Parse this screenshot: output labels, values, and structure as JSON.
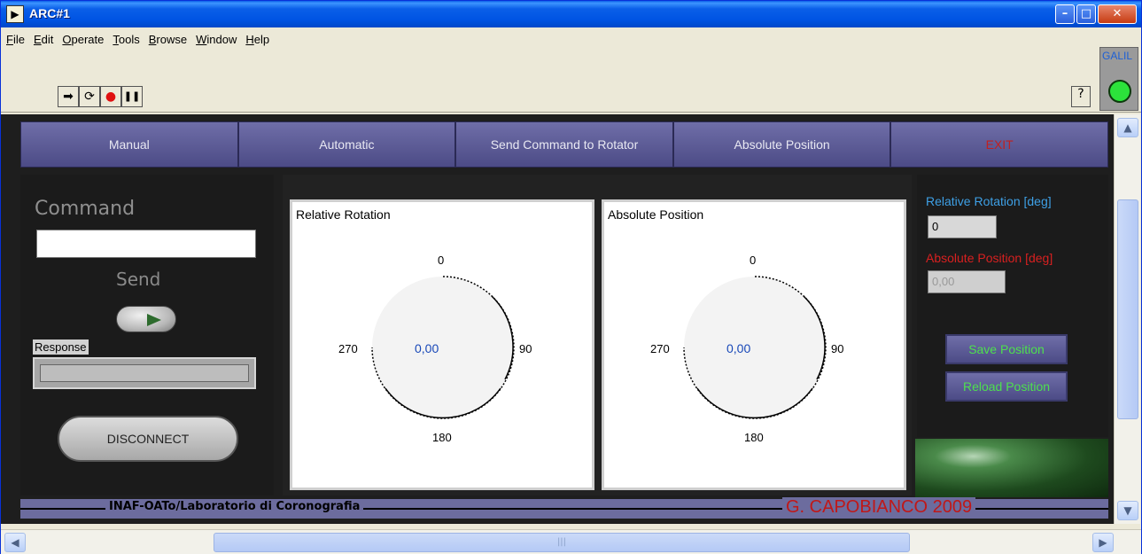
{
  "window": {
    "title": "ARC#1",
    "app_icon_glyph": "▶",
    "minimize_glyph": "–",
    "maximize_glyph": "□",
    "close_glyph": "✕"
  },
  "menu": {
    "items": [
      "File",
      "Edit",
      "Operate",
      "Tools",
      "Browse",
      "Window",
      "Help"
    ]
  },
  "toolbar": {
    "run_glyph": "➡",
    "run_continuous_glyph": "⟳",
    "abort_glyph": "●",
    "pause_glyph": "❚❚",
    "help_glyph": "?"
  },
  "galil": {
    "label": "GALIL",
    "led_color": "#2ce23b"
  },
  "tabs": [
    {
      "label": "Manual"
    },
    {
      "label": "Automatic"
    },
    {
      "label": "Send Command to Rotator"
    },
    {
      "label": "Absolute Position"
    },
    {
      "label": "EXIT"
    }
  ],
  "left": {
    "command_label": "Command",
    "command_value": "",
    "send_label": "Send",
    "response_label": "Response",
    "response_value": "",
    "disconnect_label": "DISCONNECT"
  },
  "gauges": [
    {
      "title": "Relative Rotation",
      "value": "0,00",
      "tick_top": "0",
      "tick_right": "90",
      "tick_bottom": "180",
      "tick_left": "270"
    },
    {
      "title": "Absolute Position",
      "value": "0,00",
      "tick_top": "0",
      "tick_right": "90",
      "tick_bottom": "180",
      "tick_left": "270"
    }
  ],
  "right": {
    "relative_label": "Relative Rotation [deg]",
    "relative_value": "0",
    "absolute_label": "Absolute Position [deg]",
    "absolute_value": "0,00",
    "save_label": "Save Position",
    "reload_label": "Reload Position"
  },
  "footer": {
    "left_text": "INAF-OATo/Laboratorio di Coronografia",
    "right_text": "G. CAPOBIANCO 2009"
  },
  "colors": {
    "accent_blue": "#3ea0e6",
    "accent_red": "#d82020",
    "accent_green": "#4ee04e",
    "tab_purple": "#5c5b96"
  }
}
